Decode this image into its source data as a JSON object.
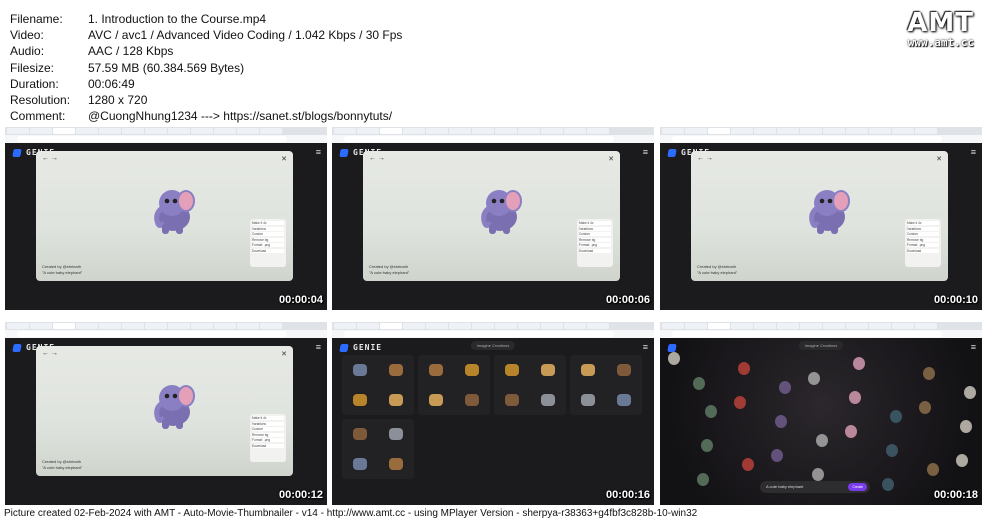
{
  "info": [
    {
      "key": "Filename:",
      "value": "1. Introduction to the Course.mp4"
    },
    {
      "key": "Video:",
      "value": "AVC / avc1 / Advanced Video Coding / 1.042 Kbps / 30 Fps"
    },
    {
      "key": "Audio:",
      "value": "AAC / 128 Kbps"
    },
    {
      "key": "Filesize:",
      "value": "57.59 MB (60.384.569 Bytes)"
    },
    {
      "key": "Duration:",
      "value": "00:06:49"
    },
    {
      "key": "Resolution:",
      "value": "1280 x 720"
    },
    {
      "key": "Comment:",
      "value": "@CuongNhung1234 ---> https://sanet.st/blogs/bonnytuts/"
    }
  ],
  "logo": {
    "title": "AMT",
    "site": "www.amt.cc"
  },
  "app": {
    "name": "GENIE",
    "menu_icon": "hamburger-icon"
  },
  "modal": {
    "credit": "Created by @shrinath",
    "prompt": "\"A cute baby elephant\"",
    "panel_items": [
      "Make it 4x",
      "Variations",
      "Custom",
      "Remove bg",
      "Format: .png",
      "Download"
    ]
  },
  "library": {
    "tabs": [
      "Imagine",
      "Creations"
    ]
  },
  "prompt_bar": {
    "text": "A cute baby elephant",
    "button": "Create"
  },
  "thumbnails": [
    {
      "timestamp": "00:00:04",
      "scene": "modal"
    },
    {
      "timestamp": "00:00:06",
      "scene": "modal"
    },
    {
      "timestamp": "00:00:10",
      "scene": "modal"
    },
    {
      "timestamp": "00:00:12",
      "scene": "modal"
    },
    {
      "timestamp": "00:00:16",
      "scene": "library"
    },
    {
      "timestamp": "00:00:18",
      "scene": "explore"
    }
  ],
  "footer": "Picture created 02-Feb-2024 with AMT - Auto-Movie-Thumbnailer - v14 - http://www.amt.cc - using MPlayer Version - sherpya-r38363+g4fbf3c828b-10-win32"
}
